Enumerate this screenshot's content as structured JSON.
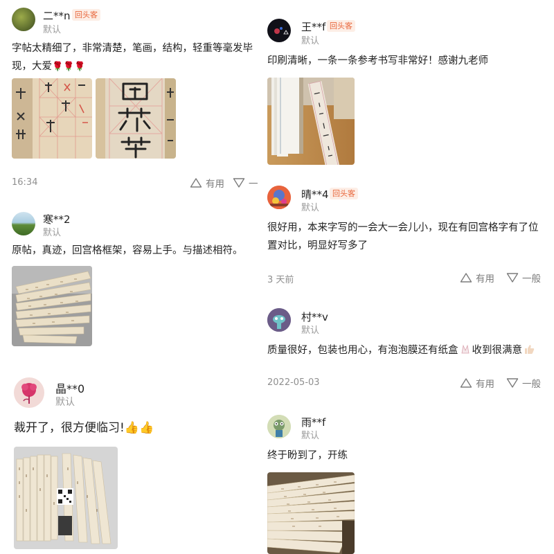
{
  "reviews": [
    {
      "user": "二**n",
      "badge": "回头客",
      "rating": "默认",
      "text": "字帖太精细了，非常清楚，笔画，结构，轻重等毫发毕现，大爱",
      "emoji": "🌹🌹🌹",
      "time": "16:34",
      "useful": "有用",
      "notuseful": "一"
    },
    {
      "user": "寒**2",
      "rating": "默认",
      "text": "原帖，真迹，回宫格框架，容易上手。与描述相符。"
    },
    {
      "user": "晶**0",
      "rating": "默认",
      "text": "裁开了，很方便临习!",
      "emoji": "👍👍"
    },
    {
      "user": "王**f",
      "badge": "回头客",
      "rating": "默认",
      "text": "印刷清晰，一条一条参考书写非常好！感谢九老师"
    },
    {
      "user": "晴**4",
      "badge": "回头客",
      "rating": "默认",
      "text": "很好用，本来字写的一会大一会儿小，现在有回宫格字有了位置对比，明显好写多了",
      "time": "3 天前",
      "useful": "有用",
      "notuseful": "一般"
    },
    {
      "user": "村**v",
      "rating": "默认",
      "text": "质量很好，包装也用心，有泡泡膜还有纸盒",
      "text2": "收到很满意",
      "time": "2022-05-03",
      "useful": "有用",
      "notuseful": "一般"
    },
    {
      "user": "雨**f",
      "rating": "默认",
      "text": "终于盼到了，开练"
    }
  ],
  "icons": {
    "up": "thumb-up-triangle-icon",
    "down": "thumb-down-triangle-icon"
  },
  "colors": {
    "badge_text": "#e8663b",
    "badge_bg": "#fdeee6"
  }
}
